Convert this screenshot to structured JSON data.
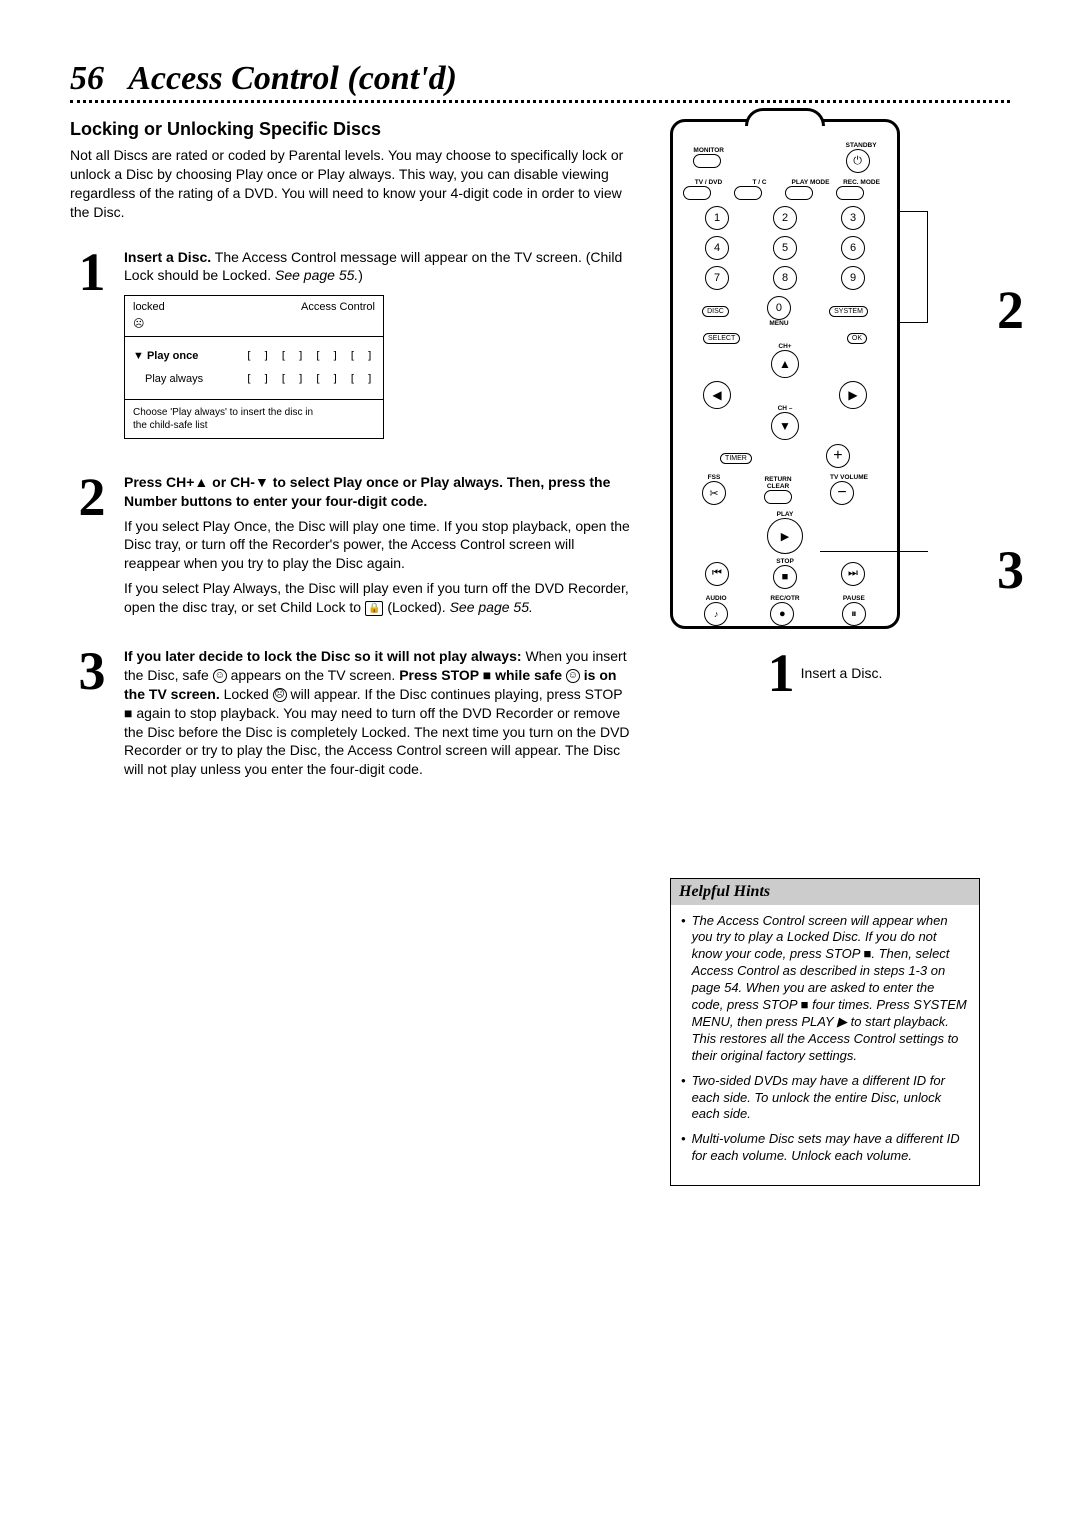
{
  "page": {
    "number": "56",
    "title": "Access Control (cont'd)"
  },
  "subhead": "Locking or Unlocking Specific Discs",
  "intro": "Not all Discs are rated or coded by Parental levels. You may choose to specifically lock or unlock a Disc by choosing Play once or Play always. This way, you can disable viewing regardless of the rating of a DVD.  You will need to know your 4-digit code in order to view the Disc.",
  "step1": {
    "num": "1",
    "bold": "Insert a Disc.",
    "text": " The Access Control message will appear on the TV screen. (Child Lock should be Locked. ",
    "see": "See page 55.",
    "close": ")",
    "tv": {
      "locked": "locked",
      "title": "Access Control",
      "play_once": "Play once",
      "play_always": "Play always",
      "code": "[ ]  [ ]  [ ]  [ ]",
      "footer1": "Choose 'Play always' to insert the disc in",
      "footer2": "the child-safe list"
    }
  },
  "step2": {
    "num": "2",
    "bold": "Press CH+▲ or CH-▼ to select Play once or Play always. Then, press the Number buttons to enter your four-digit code.",
    "p1": "If you select Play Once, the Disc will play one time. If you stop playback, open the Disc tray, or turn off the Recorder's power, the Access Control screen will reappear when you try to play the Disc again.",
    "p2a": "If you select Play Always, the Disc will play even if you turn off the DVD Recorder, open the disc tray, or set Child Lock to ",
    "p2b": " (Locked). ",
    "see": "See page 55."
  },
  "step3": {
    "num": "3",
    "bold": "If you later decide to lock the Disc so it will not play always:",
    "t1": "When you insert the Disc, safe ",
    "t2": " appears on the TV screen. ",
    "bold2": "Press STOP ■ while safe ",
    "bold3": " is on the TV screen.",
    "t3": " Locked ",
    "t4": " will appear. If the Disc continues playing, press STOP ■ again to stop playback. You may need to turn off the DVD Recorder or remove the Disc before the Disc is completely Locked. The next time you turn on the DVD Recorder or try to play the Disc, the Access Control screen will appear. The Disc will not play unless you enter the four-digit code."
  },
  "remote": {
    "monitor": "MONITOR",
    "standby": "STANDBY",
    "tvdvd": "TV / DVD",
    "tc": "T / C",
    "playmode": "PLAY MODE",
    "recmode": "REC. MODE",
    "disc": "DISC",
    "menu": "MENU",
    "system": "SYSTEM",
    "select": "SELECT",
    "ok": "OK",
    "chp": "CH+",
    "chm": "CH –",
    "timer": "TIMER",
    "fss": "FSS",
    "tvvol": "TV VOLUME",
    "return": "RETURN",
    "clear": "CLEAR",
    "play": "PLAY",
    "stop": "STOP",
    "audio": "AUDIO",
    "pause": "PAUSE",
    "recotr": "REC/OTR"
  },
  "callouts": {
    "c2": "2",
    "c3": "3",
    "c1": "1",
    "caption": "Insert a Disc."
  },
  "hints": {
    "header": "Helpful Hints",
    "h1": "The Access Control screen will appear when you try to play a Locked Disc. If you do not know your code, press STOP ■. Then, select Access Control as described in steps 1-3 on page 54.  When you are asked to enter the code, press STOP ■ four times. Press SYSTEM MENU, then press PLAY ▶ to start playback. This restores all the Access Control settings to their original factory settings.",
    "h2": "Two-sided DVDs may have a different ID for each side. To unlock the entire Disc, unlock each side.",
    "h3": "Multi-volume Disc sets may have a different ID for each volume. Unlock each volume."
  }
}
